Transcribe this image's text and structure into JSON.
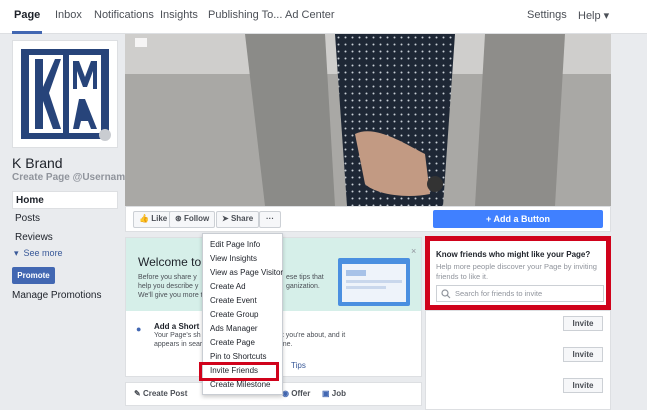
{
  "nav": {
    "tabs": [
      "Page",
      "Inbox",
      "Notifications",
      "Insights",
      "Publishing To...",
      "Ad Center"
    ],
    "settings": "Settings",
    "help": "Help ▾"
  },
  "sidebar": {
    "page_name": "K Brand",
    "username": "Create Page @Username",
    "items": [
      "Home",
      "Posts",
      "Reviews"
    ],
    "see_more": "See more",
    "promote": "Promote",
    "manage_promotions": "Manage Promotions"
  },
  "actions": {
    "like": "Like",
    "follow": "Follow",
    "share": "Share",
    "more": "···",
    "add_button": "+ Add a Button"
  },
  "menu": {
    "items": [
      "Edit Page Info",
      "View Insights",
      "View as Page Visitor",
      "Create Ad",
      "Create Event",
      "Create Group",
      "Ads Manager",
      "Create Page",
      "Pin to Shortcuts",
      "Invite Friends",
      "Create Milestone"
    ],
    "highlighted": "Invite Friends"
  },
  "welcome": {
    "title": "Welcome to Y",
    "body_left": "Before you share y\nhelp you describe y\nWe'll give you more t",
    "body_right": "ese tips that\nganization.",
    "short_desc_title": "Add a Short De",
    "short_desc_body": "Your Page's sh                    ple know what you're about, and it\nappears in sear                   ok for you online.",
    "tips_link": "Tips"
  },
  "composer": {
    "create_post": "Create Post",
    "offer": "Offer",
    "job": "Job"
  },
  "know_friends": {
    "title": "Know friends who might like your Page?",
    "subtitle": "Help more people discover your Page by inviting friends to like it.",
    "search_placeholder": "Search for friends to invite"
  },
  "invite_label": "Invite",
  "colors": {
    "accent": "#4267b2",
    "highlight": "#d0021b",
    "add_button": "#4080ff"
  }
}
